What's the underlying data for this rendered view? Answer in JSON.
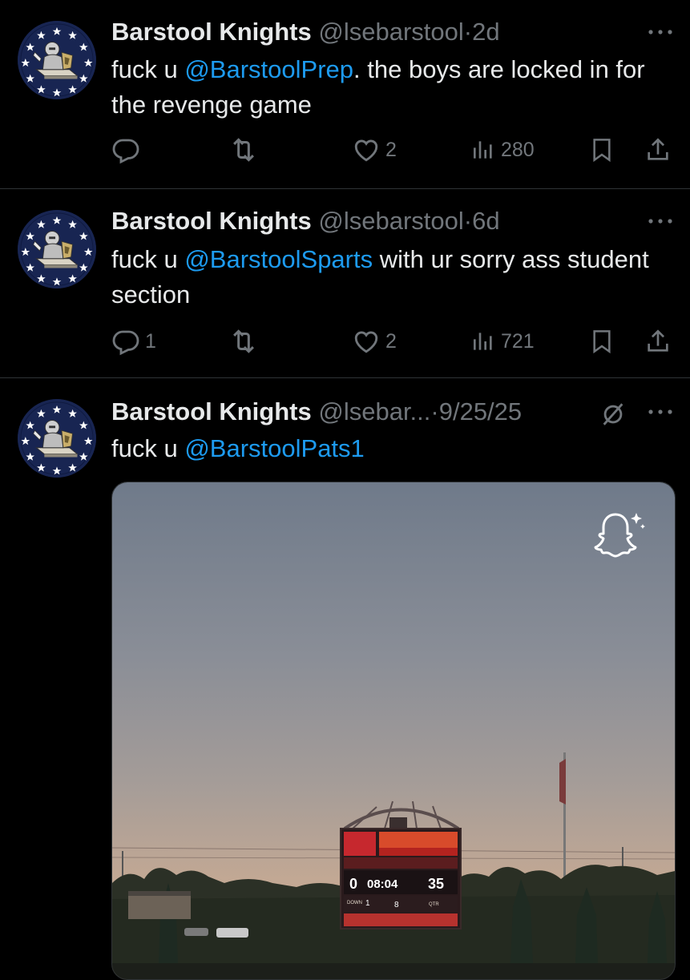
{
  "tweets": [
    {
      "name": "Barstool Knights",
      "handle": "@lsebarstool",
      "sep": "·",
      "time": "2d",
      "text_pre": "fuck u ",
      "mention": "@BarstoolPrep",
      "text_post": ". the boys are locked in for the revenge game",
      "replies": "",
      "retweets": "",
      "likes": "2",
      "views": "280"
    },
    {
      "name": "Barstool Knights",
      "handle": "@lsebarstool",
      "sep": "·",
      "time": "6d",
      "text_pre": "fuck u ",
      "mention": "@BarstoolSparts",
      "text_post": " with ur sorry ass student section",
      "replies": "1",
      "retweets": "",
      "likes": "2",
      "views": "721"
    },
    {
      "name": "Barstool Knights",
      "handle": "@lsebar...",
      "sep": "·",
      "time": "9/25/25",
      "text_pre": "fuck u ",
      "mention": "@BarstoolPats1",
      "text_post": "",
      "media": {
        "scoreboard": {
          "home_score": "0",
          "clock": "08:04",
          "away_score": "35",
          "down_label": "DOWN",
          "down": "1",
          "togo": "8",
          "qtr_label": "QTR"
        }
      }
    }
  ],
  "colors": {
    "background": "#000000",
    "text": "#e7e9ea",
    "muted": "#71767b",
    "link": "#1d9bf0",
    "divider": "#2f3336",
    "avatar_bg": "#182552"
  },
  "icons": [
    "reply-icon",
    "retweet-icon",
    "like-icon",
    "views-icon",
    "bookmark-icon",
    "share-icon",
    "more-icon",
    "grok-icon",
    "snapchat-ghost-icon"
  ]
}
